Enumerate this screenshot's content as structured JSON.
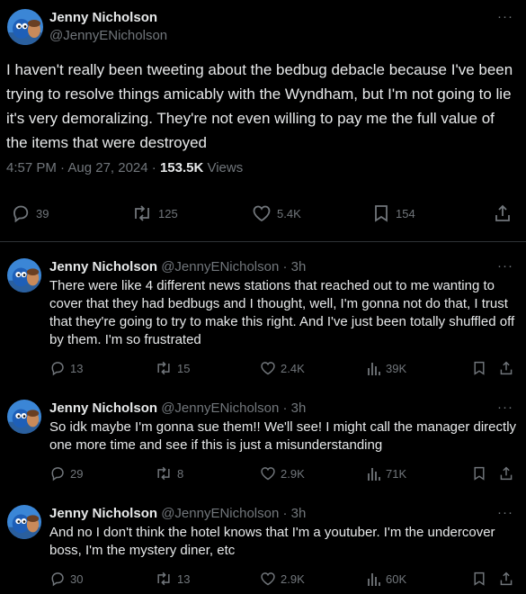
{
  "main_tweet": {
    "author_name": "Jenny Nicholson",
    "handle": "@JennyENicholson",
    "more": "···",
    "text": "I haven't really been tweeting about the bedbug debacle because I've been trying to resolve things amicably with the Wyndham, but I'm not going to lie it's very demoralizing. They're not even willing to pay me the full value of the items that were destroyed",
    "timestamp": "4:57 PM · Aug 27, 2024 · ",
    "views_count": "153.5K",
    "views_label": " Views",
    "replies": "39",
    "reposts": "125",
    "likes": "5.4K",
    "bookmarks": "154"
  },
  "replies": [
    {
      "author_name": "Jenny Nicholson",
      "handle_time": "@JennyENicholson · 3h",
      "more": "···",
      "text": "There were like 4 different news stations that reached out to me wanting to cover that they had bedbugs and I thought, well, I'm gonna not do that, I trust that they're going to try to make this right. And I've just been totally shuffled off by them. I'm so frustrated",
      "replies": "13",
      "reposts": "15",
      "likes": "2.4K",
      "views": "39K"
    },
    {
      "author_name": "Jenny Nicholson",
      "handle_time": "@JennyENicholson · 3h",
      "more": "···",
      "text": "So idk maybe I'm gonna sue them!! We'll see! I might call the manager directly one more time and see if this is just a misunderstanding",
      "replies": "29",
      "reposts": "8",
      "likes": "2.9K",
      "views": "71K"
    },
    {
      "author_name": "Jenny Nicholson",
      "handle_time": "@JennyENicholson · 3h",
      "more": "···",
      "text": "And no I don't think the hotel knows that I'm a youtuber. I'm the undercover boss, I'm the mystery diner, etc",
      "replies": "30",
      "reposts": "13",
      "likes": "2.9K",
      "views": "60K"
    }
  ],
  "icons": {
    "reply": "reply-icon",
    "repost": "repost-icon",
    "like": "like-icon",
    "views": "views-icon",
    "bookmark": "bookmark-icon",
    "share": "share-icon"
  },
  "colors": {
    "background": "#000000",
    "text": "#e7e9ea",
    "secondary": "#71767b",
    "divider": "#2f3336",
    "avatar_sky": "#3b86d6"
  }
}
